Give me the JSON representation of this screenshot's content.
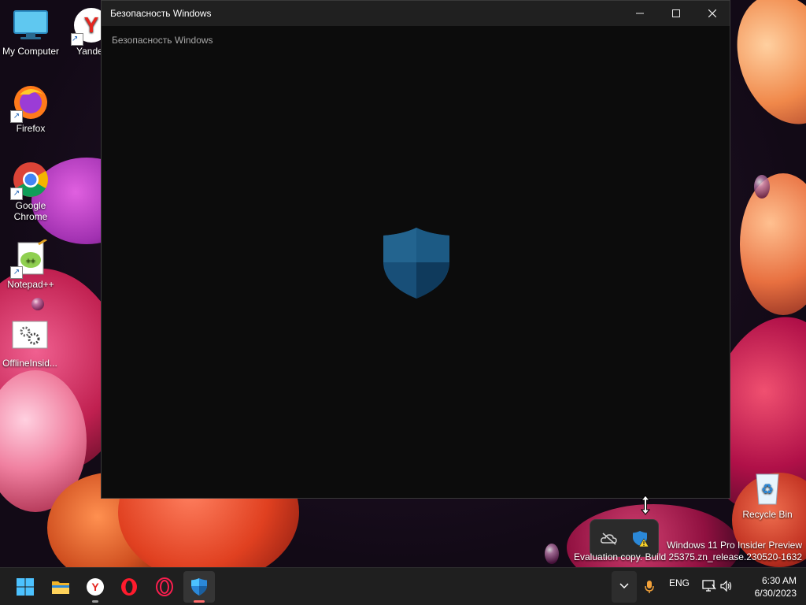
{
  "window": {
    "title": "Безопасность Windows",
    "app_header": "Безопасность Windows",
    "controls": {
      "minimize": "—",
      "maximize": "☐",
      "close": "✕"
    }
  },
  "desktop": {
    "icons": [
      {
        "label": "My Computer",
        "icon": "computer-icon",
        "shortcut": false
      },
      {
        "label": "Yande",
        "icon": "yandex-browser-icon",
        "shortcut": true
      },
      {
        "label": "Firefox",
        "icon": "firefox-icon",
        "shortcut": true
      },
      {
        "label": "Google Chrome",
        "icon": "chrome-icon",
        "shortcut": true
      },
      {
        "label": "Notepad++",
        "icon": "notepadpp-icon",
        "shortcut": true
      },
      {
        "label": "OfflineInsid...",
        "icon": "offline-insider-icon",
        "shortcut": false
      },
      {
        "label": "Recycle Bin",
        "icon": "recycle-bin-icon",
        "shortcut": false
      }
    ]
  },
  "watermark": {
    "line1": "Windows 11 Pro Insider Preview",
    "line2": "Evaluation copy. Build 25375.zn_release.230520-1632"
  },
  "taskbar": {
    "apps": [
      {
        "name": "start",
        "icon": "windows-start-icon",
        "running": false
      },
      {
        "name": "file-explorer",
        "icon": "folder-icon",
        "running": false
      },
      {
        "name": "yandex-browser",
        "icon": "yandex-browser-icon",
        "running": true
      },
      {
        "name": "opera",
        "icon": "opera-icon",
        "running": false
      },
      {
        "name": "opera-gx",
        "icon": "opera-gx-icon",
        "running": false
      },
      {
        "name": "windows-security",
        "icon": "windows-security-shield-icon",
        "running": true,
        "active": true
      }
    ],
    "tray": {
      "chevron": "⌄",
      "language": "ENG",
      "time": "6:30 AM",
      "date": "6/30/2023"
    }
  },
  "tray_flyout": {
    "icons": [
      "onedrive-offline-icon",
      "security-warning-icon"
    ]
  },
  "colors": {
    "window_bg": "#0c0c0c",
    "titlebar_bg": "#202020",
    "taskbar_bg": "#1f1f1f",
    "accent_indicator": "#ff6b6b",
    "shield_blue": "#1a5f8a"
  }
}
